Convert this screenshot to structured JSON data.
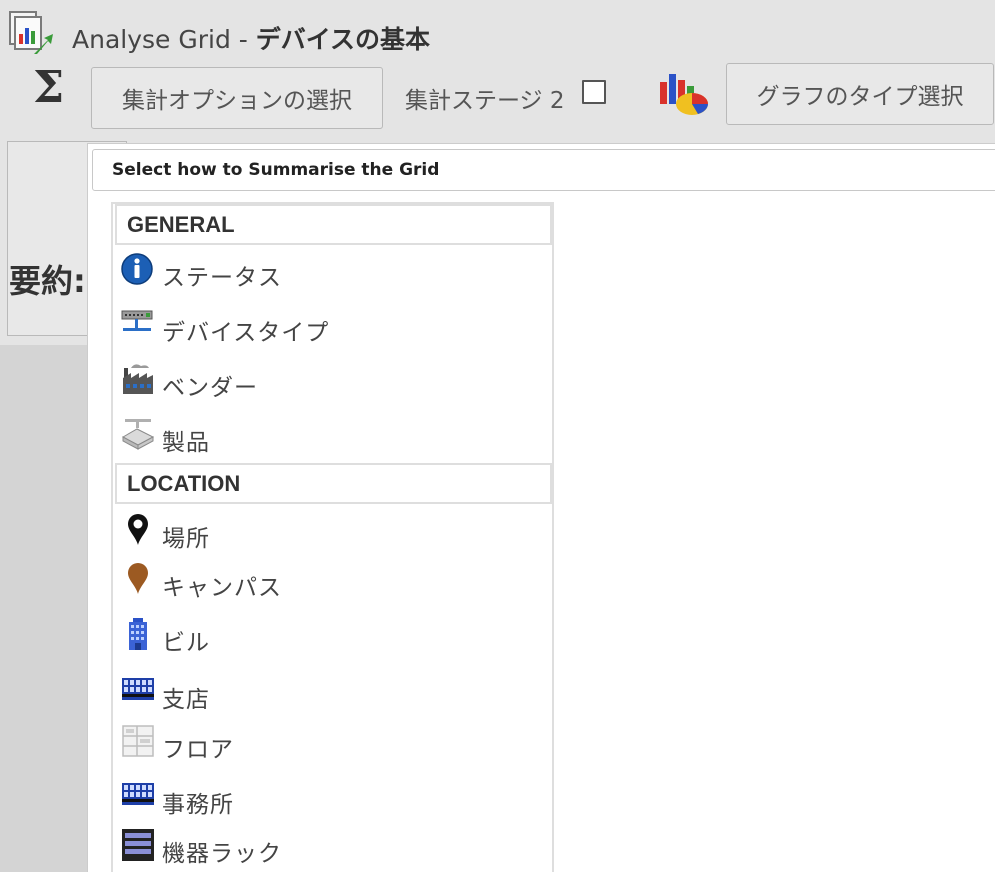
{
  "window": {
    "title_prefix": "Analyse Grid - ",
    "title_bold": "デバイスの基本"
  },
  "toolbar": {
    "sigma_symbol": "Σ",
    "summary_options_button": "集計オプションの選択",
    "stage_label": "集計ステージ 2",
    "stage_checked": false,
    "chart_type_button": "グラフのタイプ選択"
  },
  "side_panel": {
    "label": "要約:"
  },
  "dropdown": {
    "header": "Select how to Summarise the Grid",
    "groups": [
      {
        "title": "GENERAL",
        "items": [
          {
            "label": "ステータス",
            "icon": "info-icon"
          },
          {
            "label": "デバイスタイプ",
            "icon": "network-device-icon"
          },
          {
            "label": "ベンダー",
            "icon": "factory-icon"
          },
          {
            "label": "製品",
            "icon": "product-box-icon"
          }
        ]
      },
      {
        "title": "LOCATION",
        "items": [
          {
            "label": "場所",
            "icon": "map-pin-icon"
          },
          {
            "label": "キャンパス",
            "icon": "campus-pin-icon"
          },
          {
            "label": "ビル",
            "icon": "building-icon"
          },
          {
            "label": "支店",
            "icon": "branch-icon"
          },
          {
            "label": "フロア",
            "icon": "floor-icon"
          },
          {
            "label": "事務所",
            "icon": "office-icon"
          },
          {
            "label": "機器ラック",
            "icon": "rack-icon"
          }
        ]
      }
    ]
  },
  "colors": {
    "info_blue": "#1c5fb5",
    "campus_brown": "#9c5a22",
    "building_blue": "#2b52c7",
    "chart_red": "#d9322b",
    "chart_yellow": "#f0c020"
  }
}
